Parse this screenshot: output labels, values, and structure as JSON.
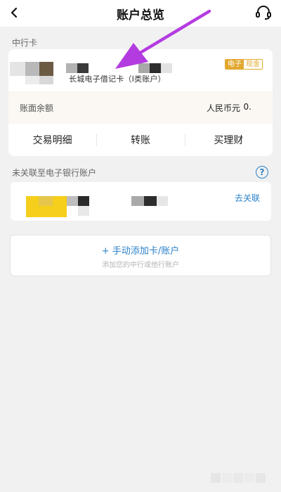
{
  "header": {
    "title": "账户总览",
    "back_icon": "chevron-left-icon",
    "service_icon": "headset-icon"
  },
  "section1": {
    "label": "中行卡"
  },
  "card": {
    "name": "长城电子借记卡（I类账户）",
    "tag_primary": "电子",
    "tag_secondary": "现金",
    "balance_label": "账面余额",
    "currency": "人民币元",
    "amount": "0.",
    "actions": [
      {
        "label": "交易明细"
      },
      {
        "label": "转账"
      },
      {
        "label": "买理财"
      }
    ]
  },
  "section2": {
    "label": "未关联至电子银行账户",
    "help_glyph": "?",
    "link_label": "去关联"
  },
  "add_card": {
    "label": "+ 手动添加卡/账户",
    "hint": "添加您的中行或他行账户"
  },
  "colors": {
    "accent": "#2b82c9",
    "tag": "#e2a72e",
    "annotation_arrow": "#b43be0"
  }
}
